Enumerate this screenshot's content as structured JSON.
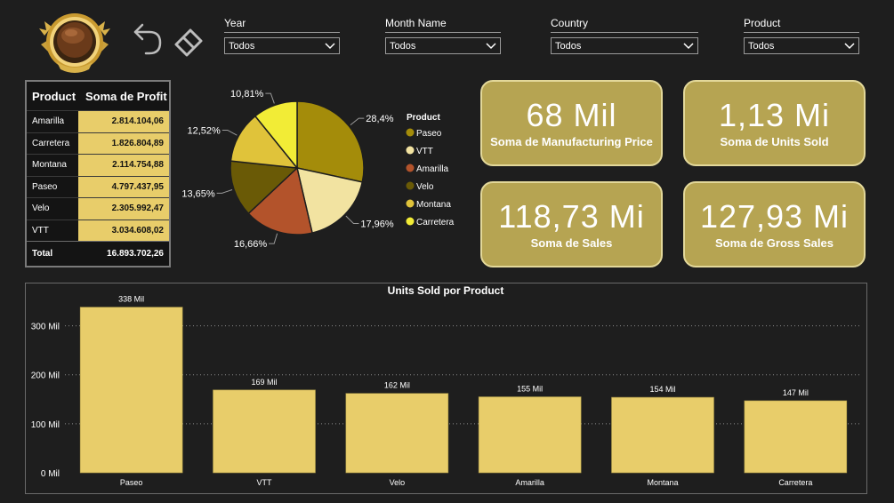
{
  "slicers": [
    {
      "title": "Year",
      "value": "Todos"
    },
    {
      "title": "Month Name",
      "value": "Todos"
    },
    {
      "title": "Country",
      "value": "Todos"
    },
    {
      "title": "Product",
      "value": "Todos"
    }
  ],
  "table": {
    "headers": [
      "Product",
      "Soma de Profit"
    ],
    "rows": [
      {
        "product": "Amarilla",
        "value": "2.814.104,06"
      },
      {
        "product": "Carretera",
        "value": "1.826.804,89"
      },
      {
        "product": "Montana",
        "value": "2.114.754,88"
      },
      {
        "product": "Paseo",
        "value": "4.797.437,95"
      },
      {
        "product": "Velo",
        "value": "2.305.992,47"
      },
      {
        "product": "VTT",
        "value": "3.034.608,02"
      }
    ],
    "total_label": "Total",
    "total_value": "16.893.702,26"
  },
  "kpis": [
    {
      "value": "68 Mil",
      "label": "Soma de Manufacturing Price"
    },
    {
      "value": "1,13 Mi",
      "label": "Soma de Units Sold"
    },
    {
      "value": "118,73 Mi",
      "label": "Soma de  Sales"
    },
    {
      "value": "127,93 Mi",
      "label": "Soma de Gross Sales"
    }
  ],
  "chart_data": [
    {
      "type": "pie",
      "legend_title": "Product",
      "legend_position": "right",
      "categories": [
        "Paseo",
        "VTT",
        "Amarilla",
        "Velo",
        "Montana",
        "Carretera"
      ],
      "values": [
        28.4,
        17.96,
        16.66,
        13.65,
        12.52,
        10.81
      ],
      "labels": [
        "28,4%",
        "17,96%",
        "16,66%",
        "13,65%",
        "12,52%",
        "10,81%"
      ],
      "colors": [
        "#a48c0a",
        "#f2e3a1",
        "#b3532b",
        "#6a5a06",
        "#e0c33a",
        "#f2ec36"
      ]
    },
    {
      "type": "bar",
      "title": "Units Sold por Product",
      "categories": [
        "Paseo",
        "VTT",
        "Velo",
        "Amarilla",
        "Montana",
        "Carretera"
      ],
      "values": [
        338,
        169,
        162,
        155,
        154,
        147
      ],
      "data_labels": [
        "338 Mil",
        "169 Mil",
        "162 Mil",
        "155 Mil",
        "154 Mil",
        "147 Mil"
      ],
      "y_ticks": [
        0,
        100,
        200,
        300
      ],
      "y_tick_labels": [
        "0 Mil",
        "100 Mil",
        "200 Mil",
        "300 Mil"
      ],
      "ylim": [
        0,
        350
      ],
      "grid": true,
      "bar_color": "#e8cd6a"
    }
  ]
}
